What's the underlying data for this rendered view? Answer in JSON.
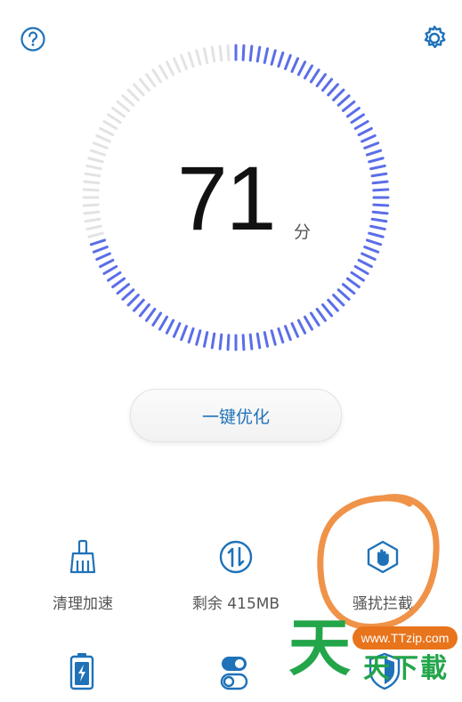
{
  "header": {
    "help_icon": "question-circle-icon",
    "settings_icon": "gear-icon"
  },
  "score": {
    "value": "71",
    "unit": "分",
    "fraction": 0.71
  },
  "optimize_button": {
    "label": "一键优化"
  },
  "tools": [
    {
      "label": "清理加速",
      "icon": "broom-icon"
    },
    {
      "label": "剩余 415MB",
      "icon": "data-transfer-icon"
    },
    {
      "label": "骚扰拦截",
      "icon": "hand-shield-icon"
    }
  ],
  "tools_row2": [
    {
      "icon": "battery-icon"
    },
    {
      "icon": "app-toggle-icon"
    },
    {
      "icon": "security-shield-icon"
    }
  ],
  "watermark": {
    "url": "www.TTzip.com",
    "big": "天",
    "small": "天下載"
  },
  "colors": {
    "accent": "#1f72b8",
    "gauge_active": "#5b6ee8",
    "gauge_inactive": "#e3e3e3",
    "annotation": "#ee8a3a",
    "watermark_green": "#23a54a"
  }
}
